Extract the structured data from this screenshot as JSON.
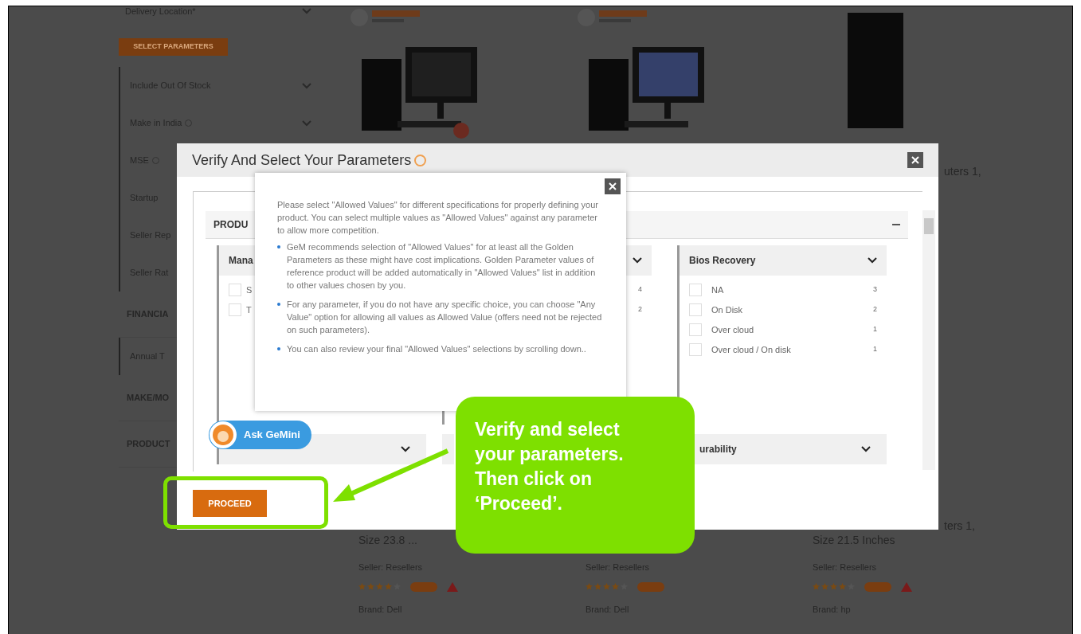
{
  "sidebar": {
    "location_label": "Delivery Location*",
    "select_button": "SELECT PARAMETERS",
    "items": [
      {
        "kind": "filter",
        "label": "Include Out Of Stock",
        "info": false
      },
      {
        "kind": "filter",
        "label": "Make in India",
        "info": true
      },
      {
        "kind": "filter",
        "label": "MSE",
        "info": true
      },
      {
        "kind": "filter",
        "label": "Startup",
        "info": false
      },
      {
        "kind": "filter",
        "label": "Seller Rep",
        "info": false
      },
      {
        "kind": "filter",
        "label": "Seller Rat",
        "info": false
      },
      {
        "kind": "heading",
        "label": "FINANCIA",
        "info": false
      },
      {
        "kind": "filter",
        "label": "Annual T",
        "info": false
      },
      {
        "kind": "heading",
        "label": "MAKE/MO",
        "info": false
      },
      {
        "kind": "heading",
        "label": "PRODUCT",
        "info": false
      }
    ]
  },
  "products": [
    {
      "title": "Size 23.8 ...",
      "seller": "Seller: Resellers",
      "stars": 4,
      "warning": true,
      "brand": "Brand: Dell"
    },
    {
      "seller": "Seller: Resellers",
      "stars": 4,
      "warning": false,
      "brand": "Brand: Dell"
    },
    {
      "title_top": "uters 1,",
      "title_tail": "ters 1,",
      "title": "Size 21.5 Inches",
      "seller": "Seller: Resellers",
      "stars": 4,
      "warning": true,
      "brand": "Brand: hp"
    }
  ],
  "modal": {
    "title": "Verify And Select Your Parameters",
    "section": "PRODU",
    "columns": [
      {
        "header": "Mana",
        "options": [
          {
            "label": "S",
            "checked": false
          },
          {
            "label": "T",
            "checked": false
          }
        ]
      },
      {
        "options": [
          {
            "count": "4"
          },
          {
            "count": "2"
          }
        ]
      },
      {
        "header": "Bios Recovery",
        "options": [
          {
            "label": "NA",
            "count": "3",
            "checked": false
          },
          {
            "label": "On Disk",
            "count": "2",
            "checked": false
          },
          {
            "label": "Over cloud",
            "count": "1",
            "checked": false
          },
          {
            "label": "Over cloud / On disk",
            "count": "1",
            "checked": false
          }
        ]
      }
    ],
    "bottom_header": "urability",
    "assistant": "Ask GeMini",
    "proceed": "PROCEED"
  },
  "popover": {
    "intro": "Please select \"Allowed Values\" for different specifications for properly defining your product. You can select multiple values as \"Allowed Values\" against any parameter to allow more competition.",
    "bullets": [
      "GeM recommends selection of \"Allowed Values\" for at least all the Golden Parameters as these might have cost implications. Golden Parameter values of reference product will be added automatically in \"Allowed Values\" list in addition to other values chosen by you.",
      "For any parameter, if you do not have any specific choice, you can choose \"Any Value\" option for allowing all values as Allowed Value (offers need not be rejected on such parameters).",
      "You can also review your final \"Allowed Values\" selections by scrolling down.."
    ]
  },
  "callout": {
    "lines": [
      "Verify and select",
      "your parameters.",
      "Then click on",
      "‘Proceed’."
    ]
  }
}
